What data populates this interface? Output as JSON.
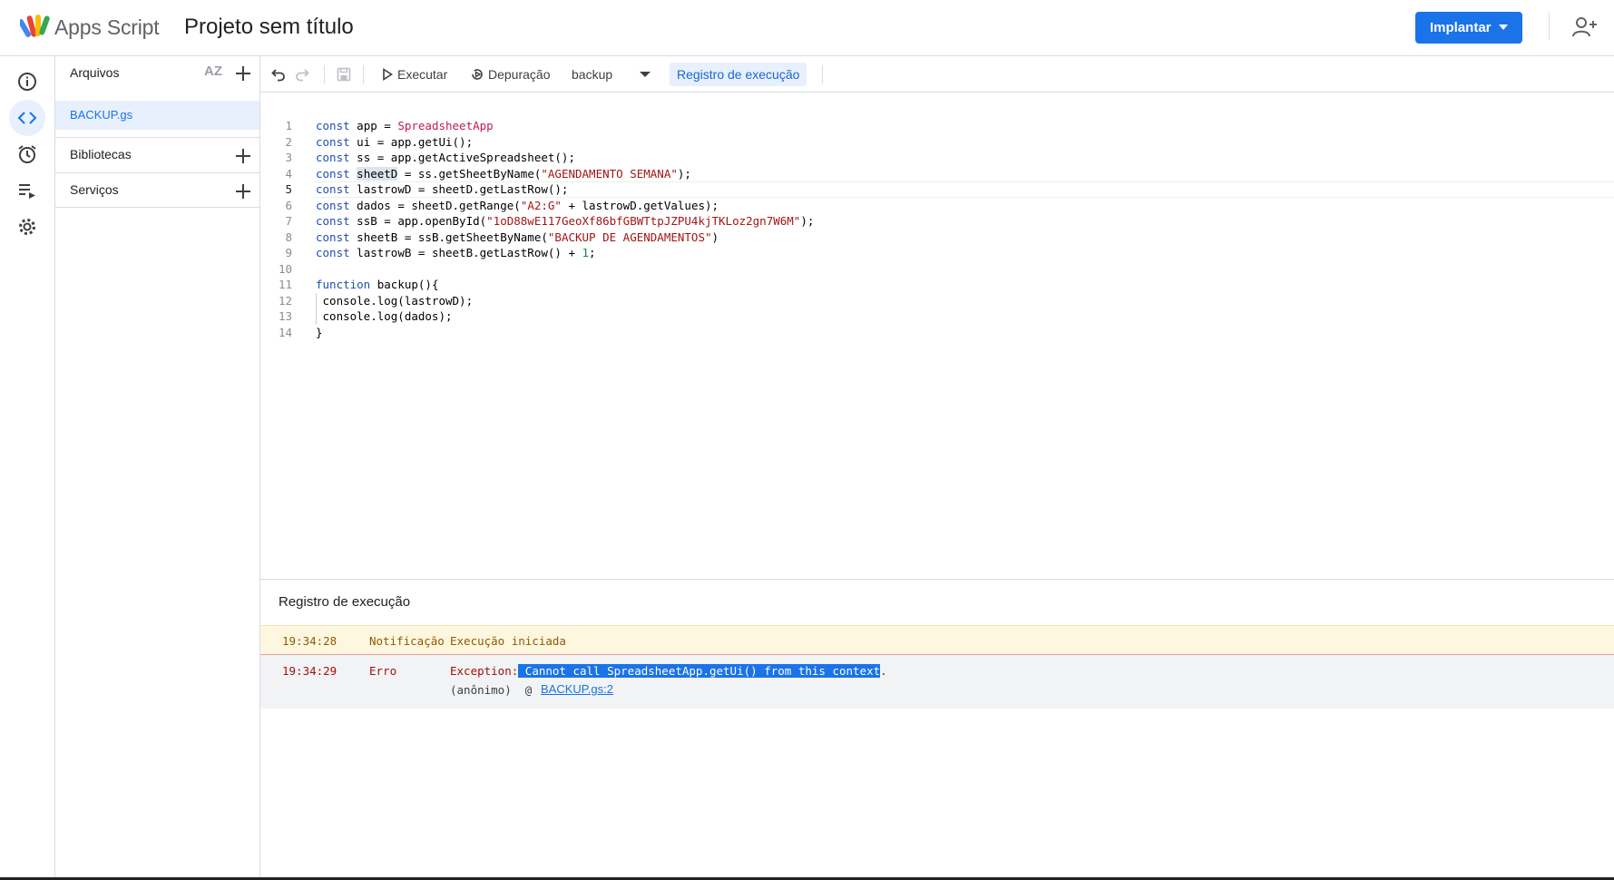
{
  "header": {
    "app_name": "Apps Script",
    "project_title": "Projeto sem título",
    "deploy_label": "Implantar"
  },
  "files_panel": {
    "files_label": "Arquivos",
    "sort_label": "AZ",
    "file_name": "BACKUP.gs",
    "libraries_label": "Bibliotecas",
    "services_label": "Serviços"
  },
  "toolbar": {
    "run_label": "Executar",
    "debug_label": "Depuração",
    "function_select": "backup",
    "execution_log_label": "Registro de execução"
  },
  "code": {
    "line_numbers": [
      "1",
      "2",
      "3",
      "4",
      "5",
      "6",
      "7",
      "8",
      "9",
      "10",
      "11",
      "12",
      "13",
      "14"
    ],
    "current_line": 5,
    "lines": [
      [
        {
          "t": "const",
          "c": "kw"
        },
        {
          "t": " app = ",
          "c": ""
        },
        {
          "t": "SpreadsheetApp",
          "c": "cls"
        }
      ],
      [
        {
          "t": "const",
          "c": "kw"
        },
        {
          "t": " ui = app.getUi();",
          "c": ""
        }
      ],
      [
        {
          "t": "const",
          "c": "kw"
        },
        {
          "t": " ss = app.getActiveSpreadsheet();",
          "c": ""
        }
      ],
      [
        {
          "t": "const",
          "c": "kw"
        },
        {
          "t": " ",
          "c": ""
        },
        {
          "t": "sheetD",
          "c": "hl"
        },
        {
          "t": " = ss.getSheetByName(",
          "c": ""
        },
        {
          "t": "\"AGENDAMENTO SEMANA\"",
          "c": "str"
        },
        {
          "t": ");",
          "c": ""
        }
      ],
      [
        {
          "t": "const",
          "c": "kw"
        },
        {
          "t": " lastrowD = sheetD.getLastRow();",
          "c": ""
        }
      ],
      [
        {
          "t": "const",
          "c": "kw"
        },
        {
          "t": " dados = sheetD.getRange(",
          "c": ""
        },
        {
          "t": "\"A2:G\"",
          "c": "str"
        },
        {
          "t": " + lastrowD.getValues);",
          "c": ""
        }
      ],
      [
        {
          "t": "const",
          "c": "kw"
        },
        {
          "t": " ssB = app.openById(",
          "c": ""
        },
        {
          "t": "\"1oD88wE117GeoXf86bfGBWTtpJZPU4kjTKLoz2gn7W6M\"",
          "c": "str"
        },
        {
          "t": ");",
          "c": ""
        }
      ],
      [
        {
          "t": "const",
          "c": "kw"
        },
        {
          "t": " sheetB = ssB.getSheetByName(",
          "c": ""
        },
        {
          "t": "\"BACKUP DE AGENDAMENTOS\"",
          "c": "str"
        },
        {
          "t": ")",
          "c": ""
        }
      ],
      [
        {
          "t": "const",
          "c": "kw"
        },
        {
          "t": " lastrowB = sheetB.getLastRow() + ",
          "c": ""
        },
        {
          "t": "1",
          "c": "num"
        },
        {
          "t": ";",
          "c": ""
        }
      ],
      [],
      [
        {
          "t": "function",
          "c": "kw"
        },
        {
          "t": " backup(){",
          "c": ""
        }
      ],
      [
        {
          "t": " console.log(lastrowD);",
          "c": ""
        }
      ],
      [
        {
          "t": " console.log(dados);",
          "c": ""
        }
      ],
      [
        {
          "t": "}",
          "c": ""
        }
      ]
    ]
  },
  "log": {
    "title": "Registro de execução",
    "entries": [
      {
        "time": "19:34:28",
        "level": "Notificação",
        "message": "Execução iniciada"
      },
      {
        "time": "19:34:29",
        "level": "Erro",
        "message_prefix": "Exception:",
        "message_selected": " Cannot call SpreadsheetApp.getUi() from this context",
        "message_suffix": ".",
        "trace_prefix": "(anônimo)  @",
        "trace_link": "BACKUP.gs:2"
      }
    ]
  }
}
